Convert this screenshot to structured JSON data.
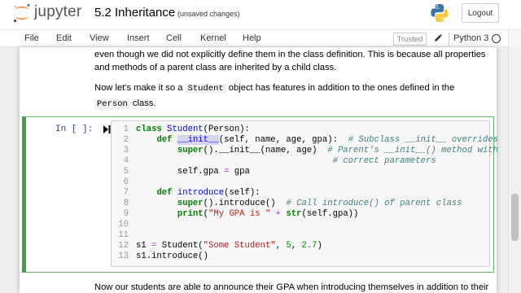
{
  "header": {
    "logo_text": "jupyter",
    "notebook_title": "5.2 Inheritance",
    "save_status": "(unsaved changes)",
    "logout_label": "Logout"
  },
  "menubar": {
    "items": [
      "File",
      "Edit",
      "View",
      "Insert",
      "Cell",
      "Kernel",
      "Help"
    ],
    "trusted_label": "Trusted",
    "kernel_name": "Python 3"
  },
  "markdown": {
    "p1_line1": "even though we did not explicitly define them in the class definition. This is because all properties",
    "p1_line2": "and methods of a parent class are inherited by a child class.",
    "p2_pre": "Now let's make it so a",
    "p2_code1": "Student",
    "p2_mid": "object has features in addition to the ones defined in the",
    "p2_code2": "Person",
    "p2_post": "class.",
    "p3": "Now our students are able to announce their GPA when introducing themselves in addition to their"
  },
  "code_cell": {
    "prompt": "In [ ]:",
    "line_numbers": [
      "1",
      "2",
      "3",
      "4",
      "5",
      "6",
      "7",
      "8",
      "9",
      "10",
      "11",
      "12",
      "13"
    ]
  },
  "colors": {
    "cell_border": "#42a145",
    "prompt": "#303f9f",
    "keyword": "#008000",
    "comment": "#408080",
    "string": "#ba2121"
  },
  "icons": {
    "logo": "jupyter-logo-icon",
    "python": "python-logo-icon",
    "pencil": "pencil-icon",
    "run": "run-cell-icon",
    "kernel_status": "kernel-idle-circle-icon"
  }
}
